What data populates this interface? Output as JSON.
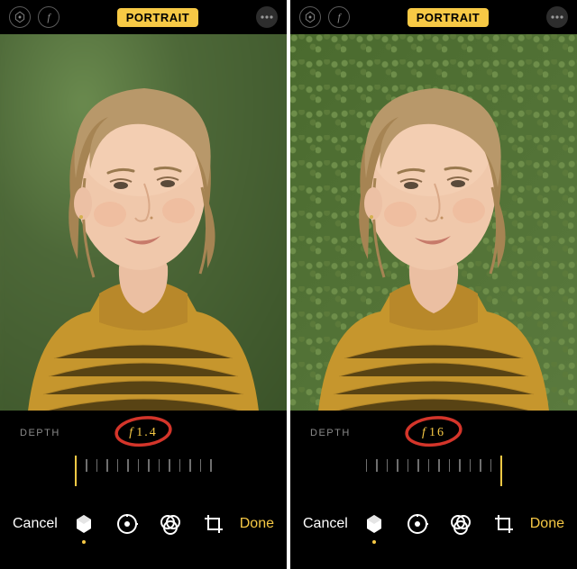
{
  "screens": {
    "left": {
      "mode_label": "PORTRAIT",
      "depth_label": "DEPTH",
      "f_symbol": "f",
      "f_value": "1.4",
      "cancel": "Cancel",
      "done": "Done"
    },
    "right": {
      "mode_label": "PORTRAIT",
      "depth_label": "DEPTH",
      "f_symbol": "f",
      "f_value": "16",
      "cancel": "Cancel",
      "done": "Done"
    }
  },
  "colors": {
    "accent": "#f7c945",
    "annotation": "#d4352a"
  }
}
